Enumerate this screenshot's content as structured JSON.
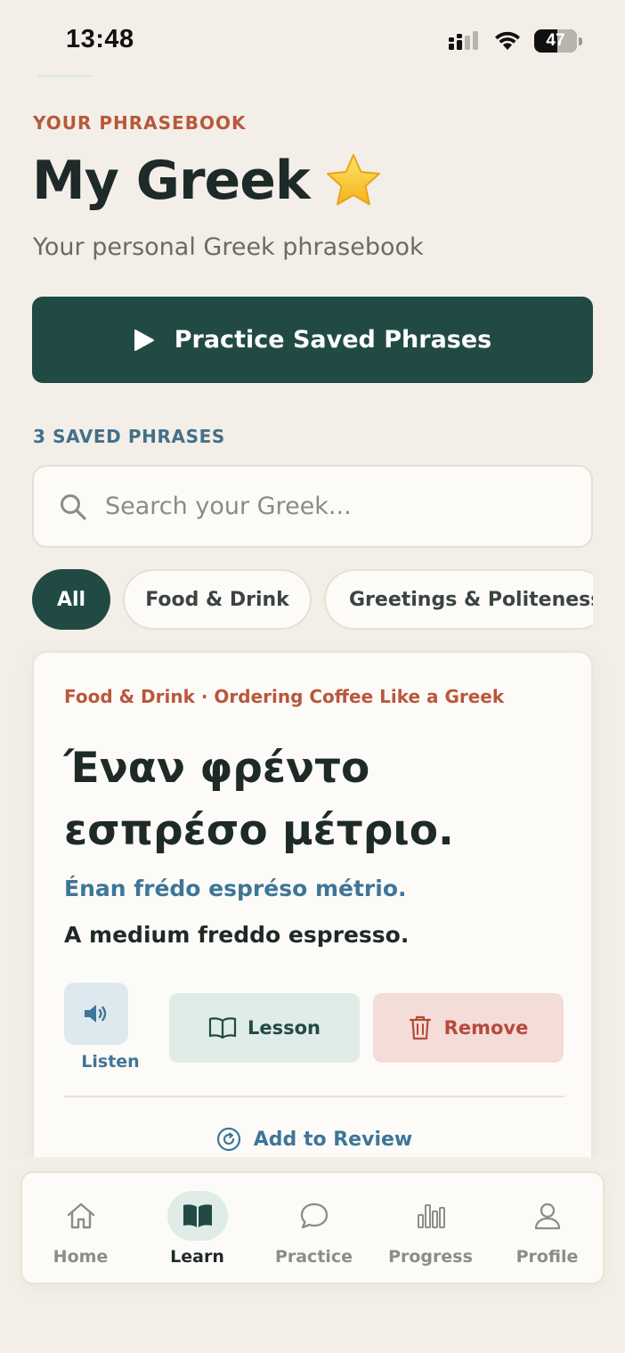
{
  "status_bar": {
    "time": "13:48",
    "battery": "47"
  },
  "header": {
    "eyebrow": "YOUR PHRASEBOOK",
    "title": "My Greek",
    "subtitle": "Your personal Greek phrasebook"
  },
  "practice_button": {
    "label": "Practice Saved Phrases"
  },
  "saved_count_label": "3 SAVED PHRASES",
  "search": {
    "placeholder": "Search your Greek...",
    "value": ""
  },
  "filters": [
    "All",
    "Food & Drink",
    "Greetings & Politeness"
  ],
  "active_filter": "All",
  "phrase_card": {
    "meta": "Food & Drink · Ordering Coffee Like a Greek",
    "greek": "Έναν φρέντο εσπρέσο μέτριο.",
    "transliteration": "Énan frédo espréso métrio.",
    "english": "A medium freddo espresso.",
    "listen_label": "Listen",
    "lesson_label": "Lesson",
    "remove_label": "Remove",
    "review_label": "Add to Review"
  },
  "tab_bar": {
    "active": "Learn",
    "tabs": [
      {
        "label": "Home",
        "icon": "home-icon"
      },
      {
        "label": "Learn",
        "icon": "book-icon"
      },
      {
        "label": "Practice",
        "icon": "chat-bubble-icon"
      },
      {
        "label": "Progress",
        "icon": "bar-chart-icon"
      },
      {
        "label": "Profile",
        "icon": "person-icon"
      }
    ]
  },
  "colors": {
    "background": "#f3efe8",
    "primary": "#224a44",
    "accent_orange": "#b8583b",
    "accent_blue": "#3e7698",
    "remove_red": "#b44a3b"
  }
}
